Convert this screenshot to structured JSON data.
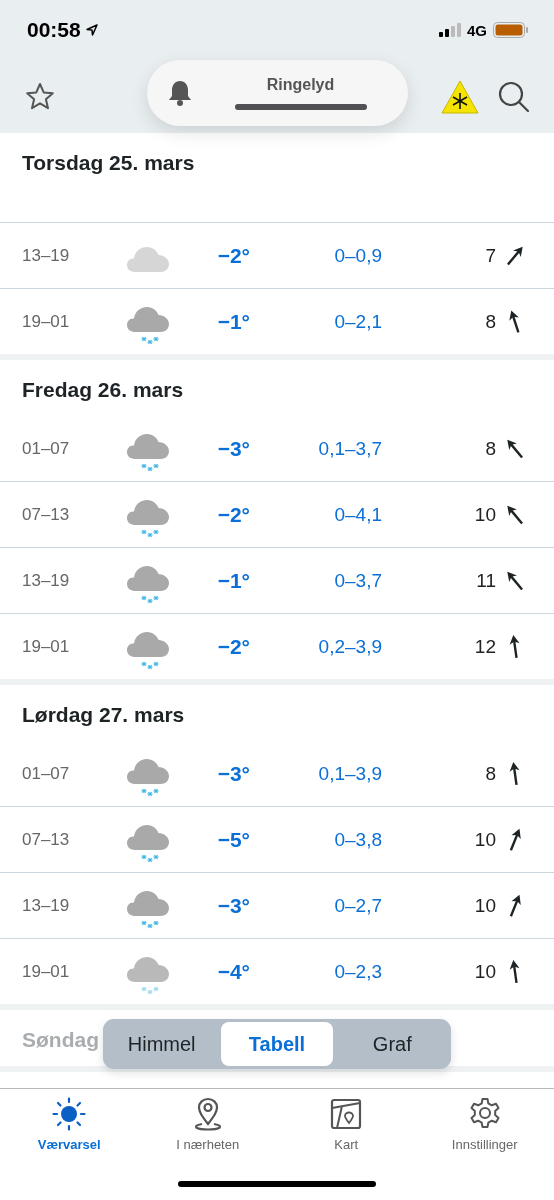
{
  "status_bar": {
    "time": "00:58",
    "network": "4G"
  },
  "header": {
    "ringer": {
      "label": "Ringelyd",
      "level": 1
    }
  },
  "days": [
    {
      "title": "Torsdag 25. mars",
      "faded": false,
      "rows": [
        {
          "time": "13–19",
          "kind": "cloud",
          "temperature": "−2°",
          "precipitation": "0–0,9",
          "wind": "7",
          "wind_arrow": {
            "kind": "NE"
          }
        },
        {
          "time": "19–01",
          "kind": "snow",
          "temperature": "−1°",
          "precipitation": "0–2,1",
          "wind": "8",
          "wind_arrow": {
            "kind": "NNW"
          }
        }
      ]
    },
    {
      "title": "Fredag 26. mars",
      "faded": false,
      "rows": [
        {
          "time": "01–07",
          "kind": "snow",
          "temperature": "−3°",
          "precipitation": "0,1–3,7",
          "wind": "8",
          "wind_arrow": {
            "kind": "NW"
          }
        },
        {
          "time": "07–13",
          "kind": "snow",
          "temperature": "−2°",
          "precipitation": "0–4,1",
          "wind": "10",
          "wind_arrow": {
            "kind": "NW"
          }
        },
        {
          "time": "13–19",
          "kind": "snow",
          "temperature": "−1°",
          "precipitation": "0–3,7",
          "wind": "11",
          "wind_arrow": {
            "kind": "NW"
          }
        },
        {
          "time": "19–01",
          "kind": "snow",
          "temperature": "−2°",
          "precipitation": "0,2–3,9",
          "wind": "12",
          "wind_arrow": {
            "kind": "N"
          }
        }
      ]
    },
    {
      "title": "Lørdag 27. mars",
      "faded": false,
      "rows": [
        {
          "time": "01–07",
          "kind": "snow",
          "temperature": "−3°",
          "precipitation": "0,1–3,9",
          "wind": "8",
          "wind_arrow": {
            "kind": "N"
          }
        },
        {
          "time": "07–13",
          "kind": "snow",
          "temperature": "−5°",
          "precipitation": "0–3,8",
          "wind": "10",
          "wind_arrow": {
            "kind": "NNE"
          }
        },
        {
          "time": "13–19",
          "kind": "snow",
          "temperature": "−3°",
          "precipitation": "0–2,7",
          "wind": "10",
          "wind_arrow": {
            "kind": "NNE"
          }
        },
        {
          "time": "19–01",
          "kind": "light-snow",
          "temperature": "−4°",
          "precipitation": "0–2,3",
          "wind": "10",
          "wind_arrow": {
            "kind": "N"
          }
        }
      ]
    },
    {
      "title": "Søndag",
      "faded": true
    }
  ],
  "view_switch": [
    {
      "label": "Himmel",
      "selected": false
    },
    {
      "label": "Tabell",
      "selected": true
    },
    {
      "label": "Graf",
      "selected": false
    }
  ],
  "tab_bar": [
    {
      "label": "Værvarsel",
      "selected": true
    },
    {
      "label": "I nærheten",
      "selected": false
    },
    {
      "label": "Kart",
      "selected": false
    },
    {
      "label": "Innstillinger",
      "selected": false
    }
  ]
}
